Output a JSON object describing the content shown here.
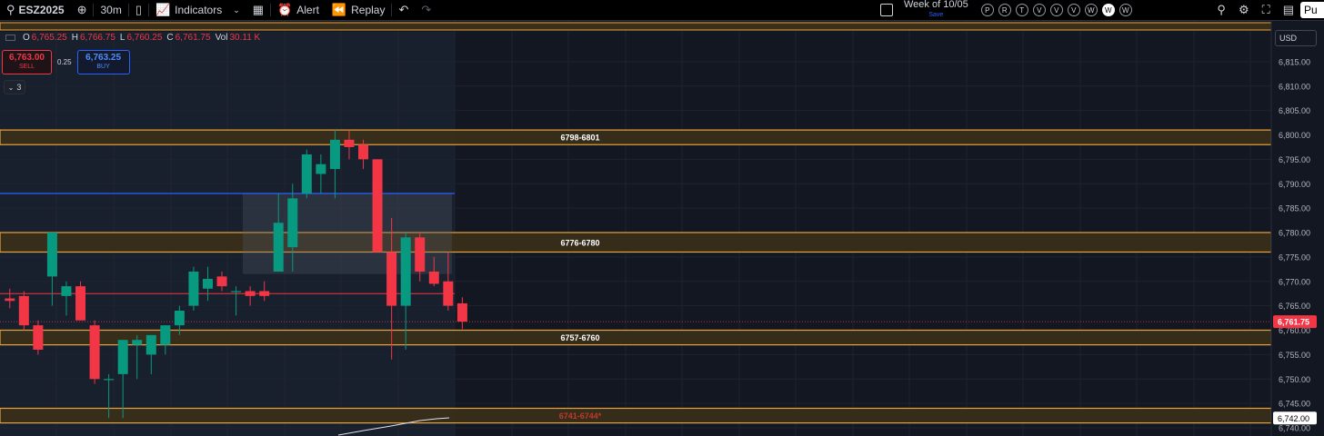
{
  "toolbar": {
    "symbol": "ESZ2025",
    "interval": "30m",
    "indicators_label": "Indicators",
    "alert_label": "Alert",
    "replay_label": "Replay",
    "week_label": "Week of 10/05",
    "week_save": "Save",
    "circle_buttons": [
      "P",
      "R",
      "T",
      "V",
      "V",
      "V",
      "W",
      "W",
      "W"
    ],
    "active_circle_index": 7,
    "publish_label": "Pu"
  },
  "legend": {
    "open_label": "O",
    "open": "6,765.25",
    "high_label": "H",
    "high": "6,766.75",
    "low_label": "L",
    "low": "6,760.25",
    "close_label": "C",
    "close": "6,761.75",
    "vol_label": "Vol",
    "vol": "30.11 K"
  },
  "trade": {
    "sell_price": "6,763.00",
    "sell_label": "SELL",
    "spread": "0.25",
    "buy_price": "6,763.25",
    "buy_label": "BUY"
  },
  "indicator_count": "3",
  "currency": "USD",
  "colors": {
    "up": "#089981",
    "down": "#f23645",
    "zone_border": "#e8a33a",
    "zone_fill": "#3b2f1a",
    "blue_line": "#2962ff",
    "red_line": "#f23645",
    "bg": "#131722",
    "grid": "#1f2330"
  },
  "chart_data": {
    "type": "candlestick",
    "ylim": [
      6740,
      6820
    ],
    "y_ticks": [
      6740,
      6745,
      6750,
      6755,
      6760,
      6765,
      6770,
      6775,
      6780,
      6785,
      6790,
      6795,
      6800,
      6805,
      6810,
      6815
    ],
    "y_tick_labels": [
      "6,740.00",
      "6,745.00",
      "6,750.00",
      "6,755.00",
      "6,760.00",
      "6,765.00",
      "6,770.00",
      "6,775.00",
      "6,780.00",
      "6,785.00",
      "6,790.00",
      "6,795.00",
      "6,800.00",
      "6,805.00",
      "6,810.00",
      "6,815.00"
    ],
    "candles": [
      {
        "o": 6766.5,
        "h": 6768.5,
        "l": 6764.5,
        "c": 6766.0
      },
      {
        "o": 6767.0,
        "h": 6768.0,
        "l": 6760.0,
        "c": 6761.0
      },
      {
        "o": 6761.0,
        "h": 6762.0,
        "l": 6755.0,
        "c": 6756.0
      },
      {
        "o": 6771.0,
        "h": 6780.0,
        "l": 6765.0,
        "c": 6780.0
      },
      {
        "o": 6767.0,
        "h": 6770.0,
        "l": 6763.0,
        "c": 6769.0
      },
      {
        "o": 6769.0,
        "h": 6770.0,
        "l": 6762.0,
        "c": 6762.0
      },
      {
        "o": 6761.0,
        "h": 6762.0,
        "l": 6749.0,
        "c": 6750.0
      },
      {
        "o": 6750.0,
        "h": 6751.0,
        "l": 6742.0,
        "c": 6750.0
      },
      {
        "o": 6751.0,
        "h": 6758.0,
        "l": 6742.0,
        "c": 6758.0
      },
      {
        "o": 6757.0,
        "h": 6759.0,
        "l": 6750.0,
        "c": 6758.0
      },
      {
        "o": 6755.0,
        "h": 6759.0,
        "l": 6751.0,
        "c": 6759.0
      },
      {
        "o": 6757.0,
        "h": 6761.0,
        "l": 6755.0,
        "c": 6761.0
      },
      {
        "o": 6761.0,
        "h": 6765.0,
        "l": 6759.0,
        "c": 6764.0
      },
      {
        "o": 6765.0,
        "h": 6773.0,
        "l": 6764.0,
        "c": 6772.0
      },
      {
        "o": 6768.5,
        "h": 6773.0,
        "l": 6766.0,
        "c": 6770.5
      },
      {
        "o": 6771.0,
        "h": 6772.0,
        "l": 6768.0,
        "c": 6769.0
      },
      {
        "o": 6768.0,
        "h": 6769.0,
        "l": 6763.0,
        "c": 6768.0
      },
      {
        "o": 6768.0,
        "h": 6769.0,
        "l": 6765.0,
        "c": 6767.0
      },
      {
        "o": 6768.0,
        "h": 6770.0,
        "l": 6766.0,
        "c": 6767.0
      },
      {
        "o": 6772.0,
        "h": 6788.0,
        "l": 6772.0,
        "c": 6782.0
      },
      {
        "o": 6777.0,
        "h": 6790.0,
        "l": 6772.0,
        "c": 6787.0
      },
      {
        "o": 6788.0,
        "h": 6797.0,
        "l": 6787.0,
        "c": 6796.0
      },
      {
        "o": 6792.0,
        "h": 6796.0,
        "l": 6788.0,
        "c": 6794.0
      },
      {
        "o": 6793.0,
        "h": 6801.0,
        "l": 6787.0,
        "c": 6799.0
      },
      {
        "o": 6799.0,
        "h": 6801.0,
        "l": 6795.0,
        "c": 6797.5
      },
      {
        "o": 6798.0,
        "h": 6799.0,
        "l": 6793.0,
        "c": 6795.0
      },
      {
        "o": 6795.0,
        "h": 6795.0,
        "l": 6776.0,
        "c": 6776.0
      },
      {
        "o": 6776.0,
        "h": 6783.0,
        "l": 6754.0,
        "c": 6765.0
      },
      {
        "o": 6765.0,
        "h": 6780.0,
        "l": 6756.0,
        "c": 6779.0
      },
      {
        "o": 6779.0,
        "h": 6780.0,
        "l": 6770.0,
        "c": 6772.0
      },
      {
        "o": 6772.0,
        "h": 6775.0,
        "l": 6769.0,
        "c": 6769.5
      },
      {
        "o": 6770.0,
        "h": 6776.0,
        "l": 6764.0,
        "c": 6765.0
      },
      {
        "o": 6765.5,
        "h": 6766.75,
        "l": 6760.25,
        "c": 6761.75
      }
    ],
    "zones": [
      {
        "low": 6798,
        "high": 6801,
        "label": "6798-6801"
      },
      {
        "low": 6776,
        "high": 6780,
        "label": "6776-6780"
      },
      {
        "low": 6757,
        "high": 6760,
        "label": "6757-6760"
      },
      {
        "low": 6741,
        "high": 6744,
        "label": "6741-6744*"
      }
    ],
    "horizontal_lines": [
      {
        "value": 6788.0,
        "color": "#2962ff"
      },
      {
        "value": 6767.5,
        "color": "#f23645"
      }
    ],
    "current_price": 6761.75,
    "current_price_label": "6,761.75",
    "secondary_price_label": "6,742.00"
  }
}
